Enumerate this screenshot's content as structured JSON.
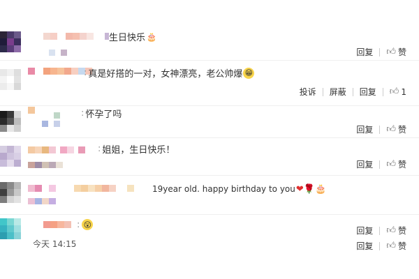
{
  "comments": [
    {
      "text": "生日快乐",
      "emoji": "🎂"
    },
    {
      "text": "真是好搭的一对，女神漂亮，老公帅爆",
      "emoji": "😁"
    },
    {
      "text": "怀孕了吗",
      "emoji": ""
    },
    {
      "text": "姐姐，生日快乐！",
      "emoji": ""
    },
    {
      "text": "19year  old.  happy birthday to you",
      "emoji": "❤🌹🎂"
    },
    {
      "text": "",
      "emoji": "😲"
    }
  ],
  "actions": {
    "reply": "回复",
    "like": "赞",
    "report": "投诉",
    "block": "屏蔽",
    "like_count_row2": "1"
  },
  "timestamp": "今天 14:15"
}
